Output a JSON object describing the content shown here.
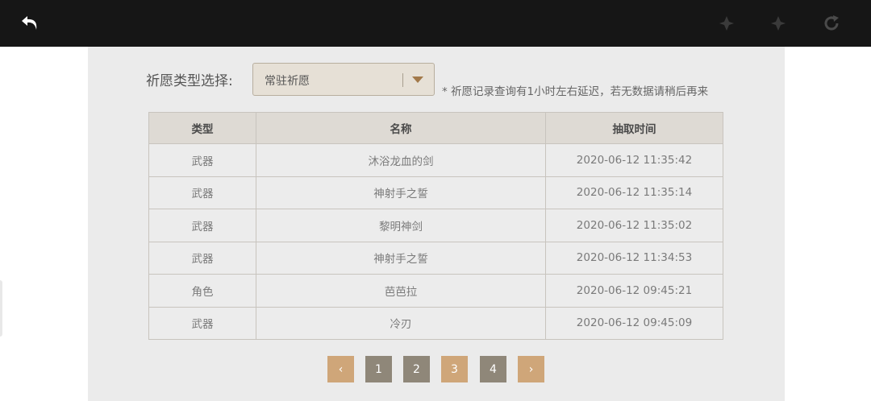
{
  "toolbar": {
    "back_icon": "back-arrow-icon",
    "forward_icon": "forward-icon",
    "reload_icon": "reload-icon"
  },
  "filter": {
    "label": "祈愿类型选择:",
    "selected": "常驻祈愿",
    "note": "* 祈愿记录查询有1小时左右延迟，若无数据请稍后再来"
  },
  "table": {
    "headers": [
      "类型",
      "名称",
      "抽取时间"
    ],
    "rows": [
      {
        "type": "武器",
        "name": "沐浴龙血的剑",
        "time": "2020-06-12 11:35:42"
      },
      {
        "type": "武器",
        "name": "神射手之誓",
        "time": "2020-06-12 11:35:14"
      },
      {
        "type": "武器",
        "name": "黎明神剑",
        "time": "2020-06-12 11:35:02"
      },
      {
        "type": "武器",
        "name": "神射手之誓",
        "time": "2020-06-12 11:34:53"
      },
      {
        "type": "角色",
        "name": "芭芭拉",
        "time": "2020-06-12 09:45:21"
      },
      {
        "type": "武器",
        "name": "冷刃",
        "time": "2020-06-12 09:45:09"
      }
    ]
  },
  "pagination": {
    "prev": "‹",
    "pages": [
      "1",
      "2",
      "3",
      "4"
    ],
    "next": "›",
    "current": "3"
  },
  "colors": {
    "topbar": "#161616",
    "panel": "#ebebeb",
    "accent_gold": "#cfa679",
    "page_gray": "#8f8779"
  }
}
